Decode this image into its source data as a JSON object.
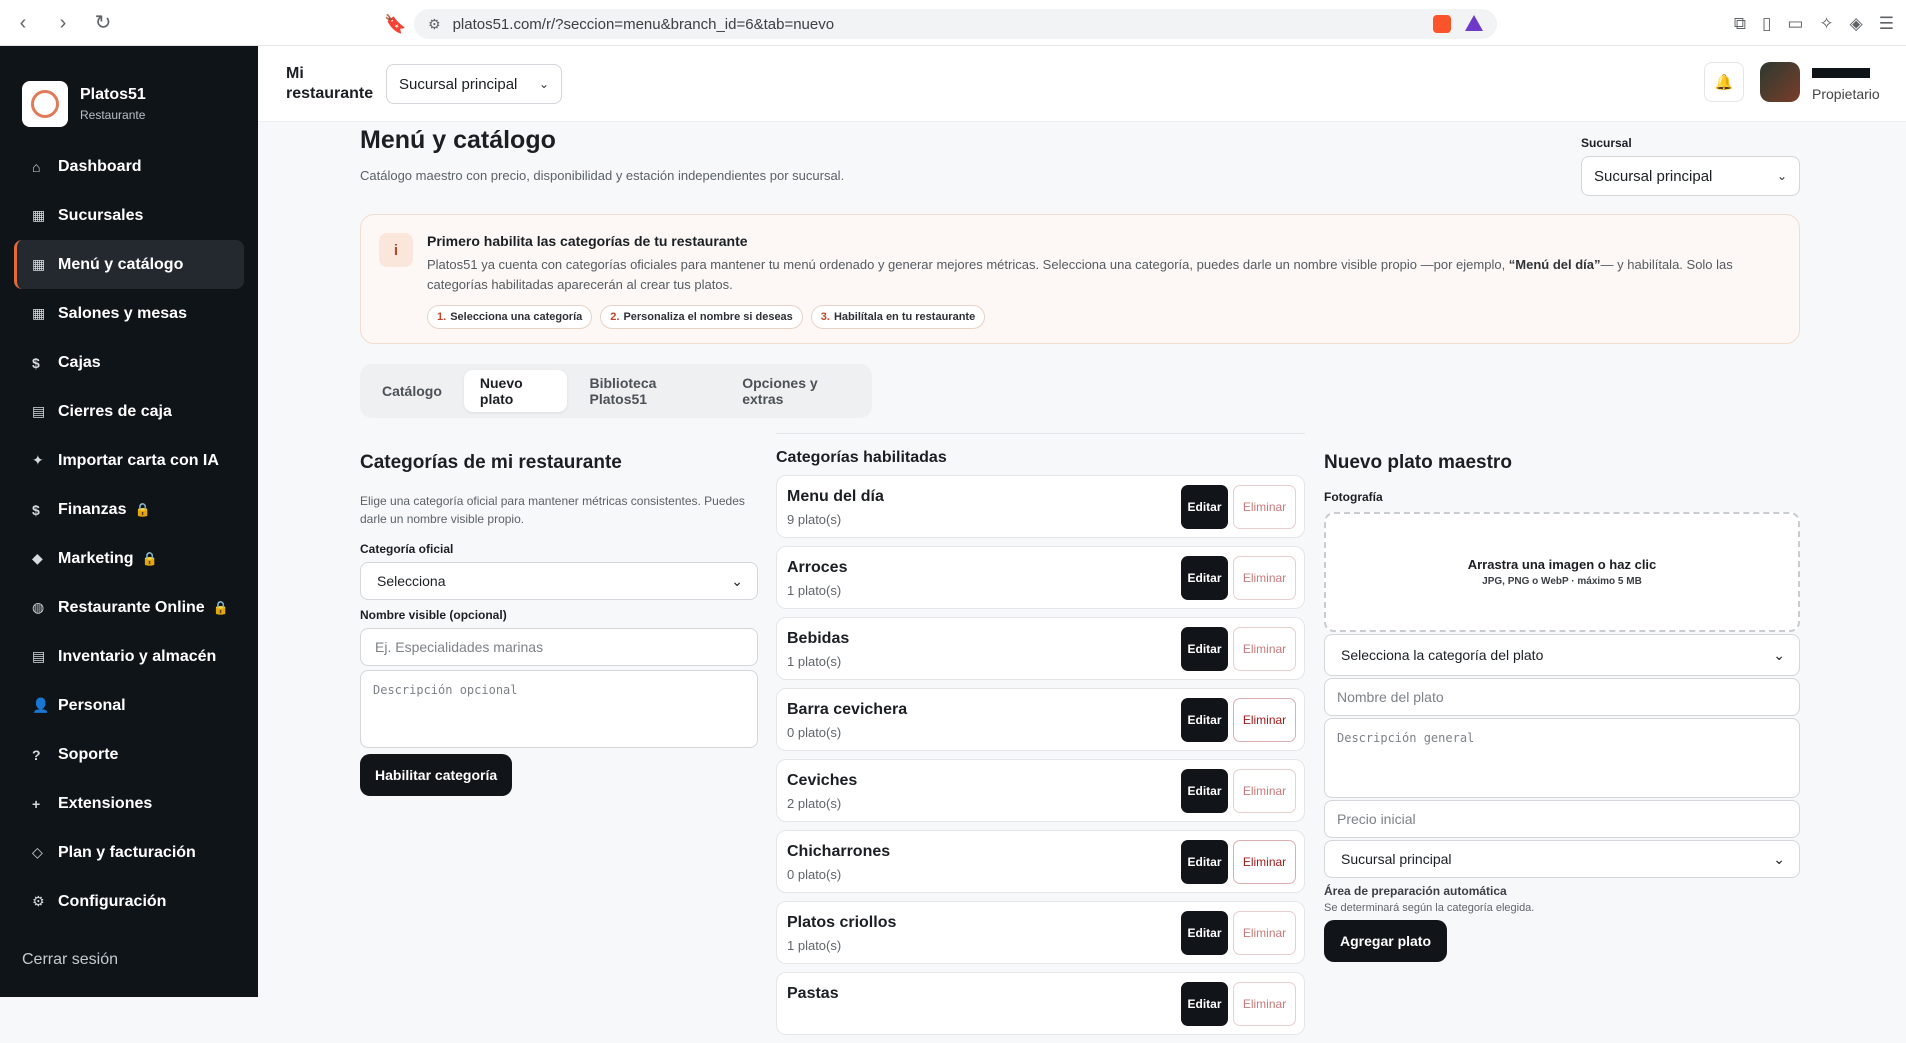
{
  "browser": {
    "url": "platos51.com/r/?seccion=menu&branch_id=6&tab=nuevo"
  },
  "sidebar": {
    "brand_name": "Platos51",
    "brand_sub": "Restaurante",
    "items": [
      {
        "label": "Dashboard",
        "icon": "⌂"
      },
      {
        "label": "Sucursales",
        "icon": "▦"
      },
      {
        "label": "Menú y catálogo",
        "icon": "▦"
      },
      {
        "label": "Salones y mesas",
        "icon": "▦"
      },
      {
        "label": "Cajas",
        "icon": "$"
      },
      {
        "label": "Cierres de caja",
        "icon": "▤"
      },
      {
        "label": "Importar carta con IA",
        "icon": "✦"
      },
      {
        "label": "Finanzas",
        "icon": "$"
      },
      {
        "label": "Marketing",
        "icon": "◆"
      },
      {
        "label": "Restaurante Online",
        "icon": "◍"
      },
      {
        "label": "Inventario y almacén",
        "icon": "▤"
      },
      {
        "label": "Personal",
        "icon": "👤"
      },
      {
        "label": "Soporte",
        "icon": "?"
      },
      {
        "label": "Extensiones",
        "icon": "+"
      },
      {
        "label": "Plan y facturación",
        "icon": "◇"
      },
      {
        "label": "Configuración",
        "icon": "⚙"
      }
    ],
    "logout": "Cerrar sesión"
  },
  "header": {
    "title_line1": "Mi",
    "title_line2": "restaurante",
    "branch_select": "Sucursal principal",
    "user_role": "Propietario"
  },
  "page": {
    "title": "Menú y catálogo",
    "subtitle": "Catálogo maestro con precio, disponibilidad y estación independientes por sucursal.",
    "branch_label": "Sucursal",
    "branch_select": "Sucursal principal"
  },
  "notice": {
    "icon": "i",
    "title": "Primero habilita las categorías de tu restaurante",
    "text_before": "Platos51 ya cuenta con categorías oficiales para mantener tu menú ordenado y generar mejores métricas. Selecciona una categoría, puedes darle un nombre visible propio —por ejemplo, ",
    "text_bold": "“Menú del día”",
    "text_after": "— y habilítala. Solo las categorías habilitadas aparecerán al crear tus platos.",
    "steps": [
      {
        "n": "1.",
        "label": "Selecciona una categoría"
      },
      {
        "n": "2.",
        "label": "Personaliza el nombre si deseas"
      },
      {
        "n": "3.",
        "label": "Habilítala en tu restaurante"
      }
    ]
  },
  "tabs": [
    "Catálogo",
    "Nuevo plato",
    "Biblioteca Platos51",
    "Opciones y extras"
  ],
  "categories_form": {
    "title": "Categorías de mi restaurante",
    "help": "Elige una categoría oficial para mantener métricas consistentes. Puedes darle un nombre visible propio.",
    "official_label": "Categoría oficial",
    "official_value": "Selecciona",
    "visible_label": "Nombre visible (opcional)",
    "visible_placeholder": "Ej. Especialidades marinas",
    "desc_placeholder": "Descripción opcional",
    "submit": "Habilitar categoría"
  },
  "enabled": {
    "title": "Categorías habilitadas",
    "edit_label": "Editar",
    "delete_label": "Eliminar",
    "items": [
      {
        "name": "Menu del día",
        "count": "9 plato(s)"
      },
      {
        "name": "Arroces",
        "count": "1 plato(s)"
      },
      {
        "name": "Bebidas",
        "count": "1 plato(s)"
      },
      {
        "name": "Barra cevichera",
        "count": "0 plato(s)"
      },
      {
        "name": "Ceviches",
        "count": "2 plato(s)"
      },
      {
        "name": "Chicharrones",
        "count": "0 plato(s)"
      },
      {
        "name": "Platos criollos",
        "count": "1 plato(s)"
      },
      {
        "name": "Pastas",
        "count": ""
      }
    ]
  },
  "new_dish": {
    "title": "Nuevo plato maestro",
    "photo_label": "Fotografía",
    "photo_drop": "Arrastra una imagen o haz clic",
    "photo_formats": "JPG, PNG o WebP · máximo 5 MB",
    "category_select": "Selecciona la categoría del plato",
    "name_placeholder": "Nombre del plato",
    "desc_placeholder": "Descripción general",
    "price_placeholder": "Precio inicial",
    "branch_select": "Sucursal principal",
    "area_label": "Área de preparación automática",
    "area_help": "Se determinará según la categoría elegida.",
    "submit": "Agregar plato"
  }
}
